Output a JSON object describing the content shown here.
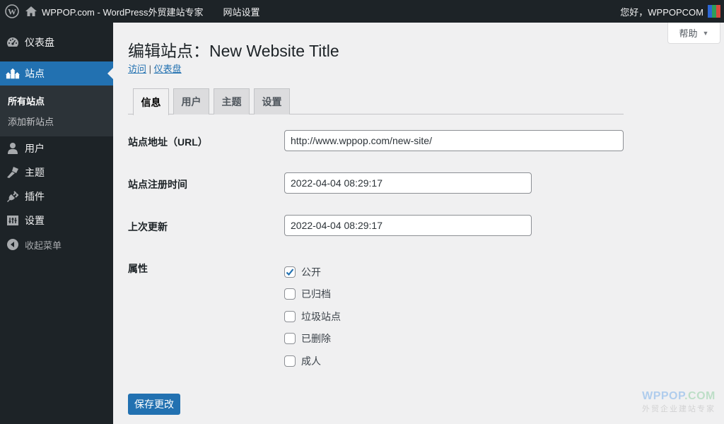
{
  "adminbar": {
    "site_name": "WPPOP.com - WordPress外贸建站专家",
    "network_settings": "网站设置",
    "greeting": "您好，WPPOPCOM"
  },
  "help": {
    "label": "帮助"
  },
  "sidebar": {
    "items": [
      {
        "label": "仪表盘",
        "icon": "dashboard-icon"
      },
      {
        "label": "站点",
        "icon": "sites-icon",
        "active": true
      },
      {
        "label": "用户",
        "icon": "users-icon"
      },
      {
        "label": "主题",
        "icon": "appearance-icon"
      },
      {
        "label": "插件",
        "icon": "plugins-icon"
      },
      {
        "label": "设置",
        "icon": "settings-icon"
      },
      {
        "label": "收起菜单",
        "icon": "collapse-icon"
      }
    ],
    "submenu": [
      {
        "label": "所有站点",
        "current": true
      },
      {
        "label": "添加新站点"
      }
    ]
  },
  "page": {
    "title": "编辑站点：New Website Title",
    "links": {
      "visit": "访问",
      "separator": " | ",
      "dashboard": "仪表盘"
    }
  },
  "tabs": [
    {
      "label": "信息",
      "active": true
    },
    {
      "label": "用户"
    },
    {
      "label": "主题"
    },
    {
      "label": "设置"
    }
  ],
  "form": {
    "url": {
      "label": "站点地址（URL）",
      "value": "http://www.wppop.com/new-site/"
    },
    "registered": {
      "label": "站点注册时间",
      "value": "2022-04-04 08:29:17"
    },
    "last_updated": {
      "label": "上次更新",
      "value": "2022-04-04 08:29:17"
    },
    "attributes": {
      "label": "属性",
      "options": [
        {
          "label": "公开",
          "checked": true
        },
        {
          "label": "已归档",
          "checked": false
        },
        {
          "label": "垃圾站点",
          "checked": false
        },
        {
          "label": "已删除",
          "checked": false
        },
        {
          "label": "成人",
          "checked": false
        }
      ]
    },
    "save_label": "保存更改"
  },
  "watermark": {
    "brand_a": "WPPOP",
    "brand_b": ".COM",
    "tagline": "外贸企业建站专家"
  },
  "colors": {
    "accent": "#2271b1",
    "adminbar": "#1d2327",
    "background": "#f0f0f1"
  }
}
